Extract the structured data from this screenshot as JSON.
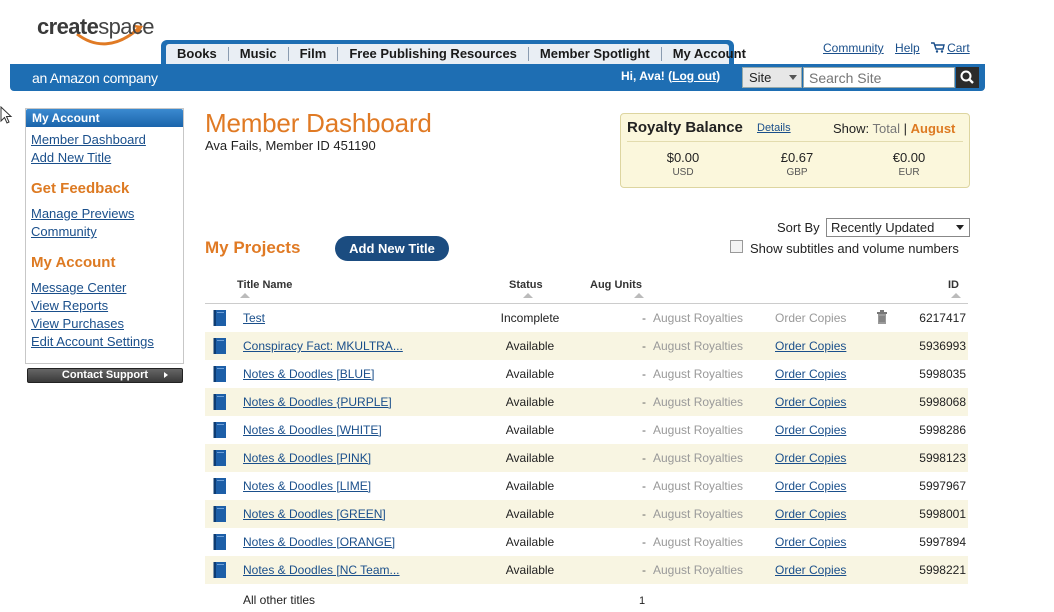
{
  "header": {
    "logo_create": "create",
    "logo_space": "space",
    "tagline": "an Amazon company",
    "tabs": [
      "Books",
      "Music",
      "Film",
      "Free Publishing Resources",
      "Member Spotlight",
      "My Account"
    ],
    "top_links": {
      "community": "Community",
      "help": "Help",
      "cart": "Cart"
    },
    "greeting": "Hi, Ava! (",
    "logout": "Log out",
    "greeting_end": ")",
    "site_select": "Site",
    "search_placeholder": "Search Site"
  },
  "sidebar": {
    "head": "My Account",
    "items1": [
      "Member Dashboard",
      "Add New Title"
    ],
    "section_feedback": "Get Feedback",
    "items2": [
      "Manage Previews",
      "Community"
    ],
    "section_account": "My Account",
    "items3": [
      "Message Center",
      "View Reports",
      "View Purchases",
      "Edit Account Settings"
    ],
    "contact": "Contact Support"
  },
  "main": {
    "title": "Member Dashboard",
    "member": "Ava Fails, Member ID 451190",
    "royalty": {
      "title": "Royalty Balance",
      "details": "Details",
      "show_label": "Show:",
      "total": "Total",
      "august": "August",
      "currencies": [
        {
          "amount": "$0.00",
          "code": "USD"
        },
        {
          "amount": "£0.67",
          "code": "GBP"
        },
        {
          "amount": "€0.00",
          "code": "EUR"
        }
      ]
    },
    "projects_title": "My Projects",
    "add_new_title": "Add New Title",
    "sort_label": "Sort By",
    "sort_value": "Recently Updated",
    "show_subtitles": "Show subtitles and volume numbers",
    "columns": {
      "title": "Title Name",
      "status": "Status",
      "units": "Aug Units",
      "id": "ID"
    },
    "rows": [
      {
        "name": "Test",
        "status": "Incomplete",
        "units": "-",
        "royalties": "August Royalties",
        "order": "Order Copies",
        "order_enabled": false,
        "trash": true,
        "id": "6217417"
      },
      {
        "name": "Conspiracy Fact: MKULTRA...",
        "status": "Available",
        "units": "-",
        "royalties": "August Royalties",
        "order": "Order Copies",
        "order_enabled": true,
        "trash": false,
        "id": "5936993"
      },
      {
        "name": "Notes & Doodles [BLUE]",
        "status": "Available",
        "units": "-",
        "royalties": "August Royalties",
        "order": "Order Copies",
        "order_enabled": true,
        "trash": false,
        "id": "5998035"
      },
      {
        "name": "Notes & Doodles {PURPLE]",
        "status": "Available",
        "units": "-",
        "royalties": "August Royalties",
        "order": "Order Copies",
        "order_enabled": true,
        "trash": false,
        "id": "5998068"
      },
      {
        "name": "Notes & Doodles [WHITE]",
        "status": "Available",
        "units": "-",
        "royalties": "August Royalties",
        "order": "Order Copies",
        "order_enabled": true,
        "trash": false,
        "id": "5998286"
      },
      {
        "name": "Notes & Doodles [PINK]",
        "status": "Available",
        "units": "-",
        "royalties": "August Royalties",
        "order": "Order Copies",
        "order_enabled": true,
        "trash": false,
        "id": "5998123"
      },
      {
        "name": "Notes & Doodles [LIME]",
        "status": "Available",
        "units": "-",
        "royalties": "August Royalties",
        "order": "Order Copies",
        "order_enabled": true,
        "trash": false,
        "id": "5997967"
      },
      {
        "name": "Notes & Doodles [GREEN]",
        "status": "Available",
        "units": "-",
        "royalties": "August Royalties",
        "order": "Order Copies",
        "order_enabled": true,
        "trash": false,
        "id": "5998001"
      },
      {
        "name": "Notes & Doodles [ORANGE]",
        "status": "Available",
        "units": "-",
        "royalties": "August Royalties",
        "order": "Order Copies",
        "order_enabled": true,
        "trash": false,
        "id": "5997894"
      },
      {
        "name": "Notes & Doodles [NC Team...",
        "status": "Available",
        "units": "-",
        "royalties": "August Royalties",
        "order": "Order Copies",
        "order_enabled": true,
        "trash": false,
        "id": "5998221"
      }
    ],
    "other_titles": "All other titles",
    "other_count": "1"
  }
}
